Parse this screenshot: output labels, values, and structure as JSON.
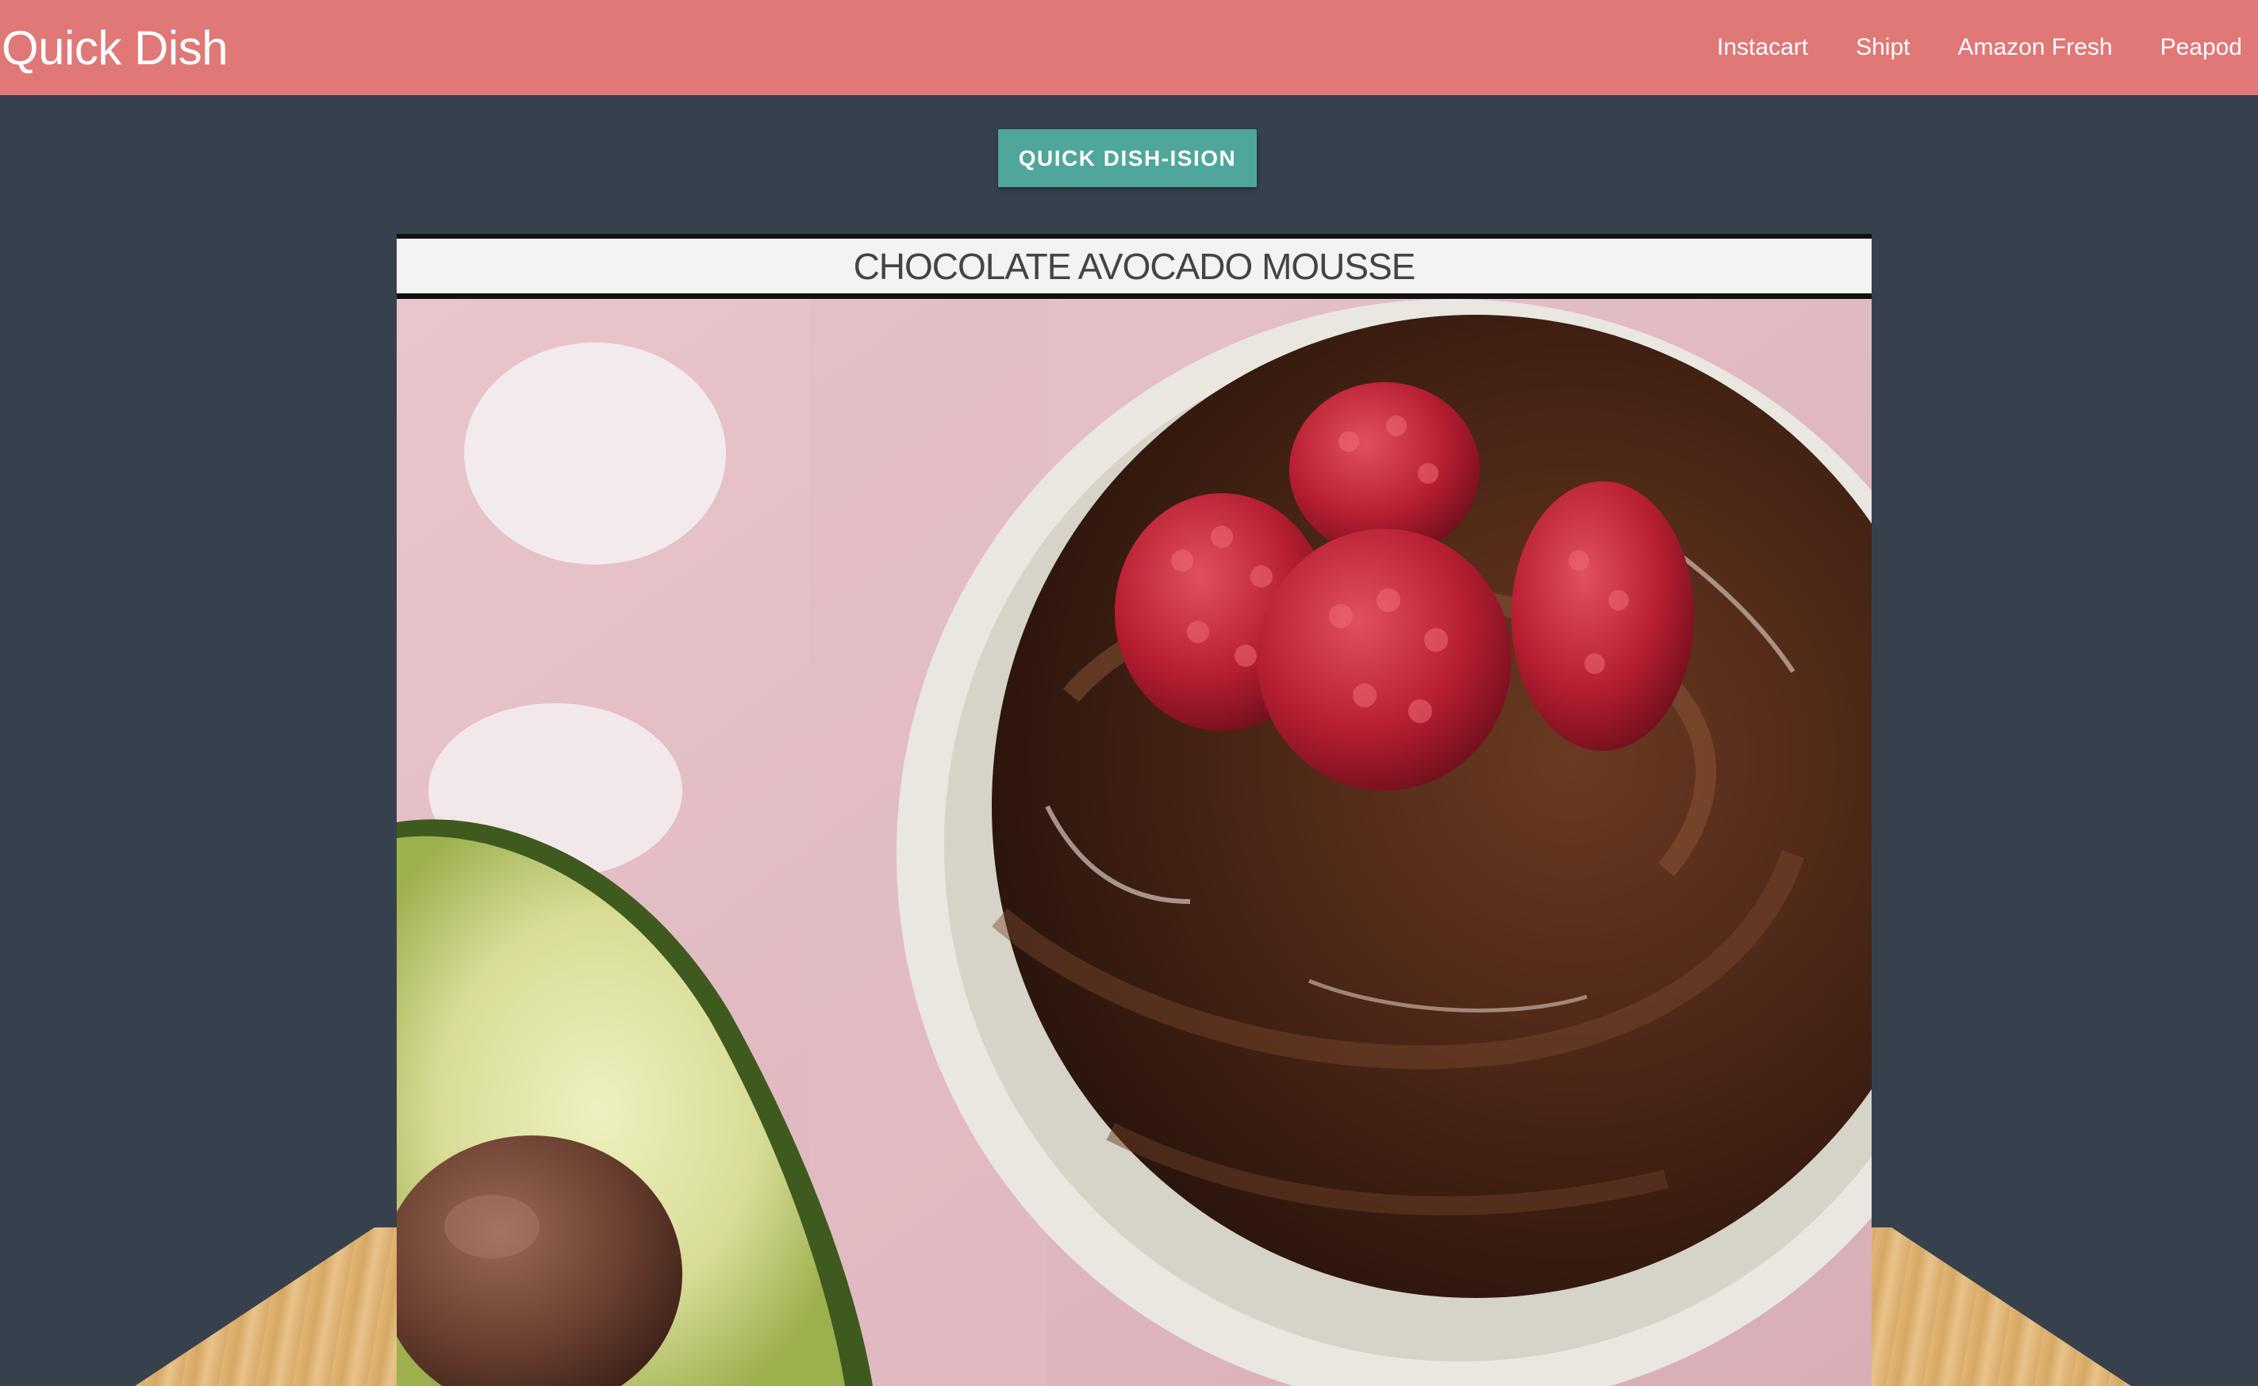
{
  "navbar": {
    "brand": "Quick Dish",
    "links": [
      "Instacart",
      "Shipt",
      "Amazon Fresh",
      "Peapod"
    ]
  },
  "action_button": {
    "label": "QUICK DISH-ISION"
  },
  "recipe": {
    "title": "CHOCOLATE AVOCADO MOUSSE"
  },
  "colors": {
    "navbar": "#e07878",
    "background": "#37414d",
    "button": "#4ea79a",
    "card_header": "#f3f3f3"
  }
}
